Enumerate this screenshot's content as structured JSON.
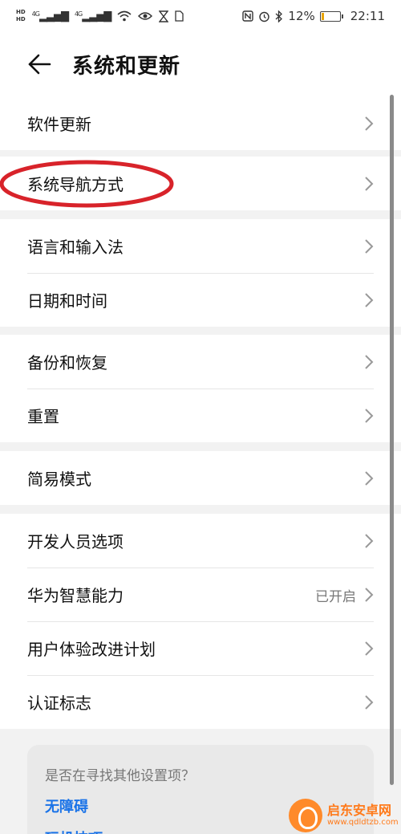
{
  "status_bar": {
    "left_hd1": "HD",
    "left_hd2": "HD",
    "net1": "4G",
    "net2": "4G",
    "icons": [
      "signal-icon",
      "wifi-icon",
      "eye-icon",
      "hourglass-icon",
      "sim-icon"
    ],
    "right_icons": [
      "nfc-icon",
      "alarm-icon",
      "bluetooth-icon"
    ],
    "battery_percent": "12%",
    "battery_level": 0.12,
    "time": "22:11"
  },
  "header": {
    "title": "系统和更新"
  },
  "groups": [
    {
      "items": [
        {
          "label": "软件更新",
          "value": ""
        }
      ]
    },
    {
      "items": [
        {
          "label": "系统导航方式",
          "value": ""
        }
      ]
    },
    {
      "items": [
        {
          "label": "语言和输入法",
          "value": ""
        },
        {
          "label": "日期和时间",
          "value": ""
        }
      ]
    },
    {
      "items": [
        {
          "label": "备份和恢复",
          "value": ""
        },
        {
          "label": "重置",
          "value": ""
        }
      ]
    },
    {
      "items": [
        {
          "label": "简易模式",
          "value": ""
        }
      ]
    },
    {
      "items": [
        {
          "label": "开发人员选项",
          "value": ""
        },
        {
          "label": "华为智慧能力",
          "value": "已开启"
        },
        {
          "label": "用户体验改进计划",
          "value": ""
        },
        {
          "label": "认证标志",
          "value": ""
        }
      ]
    }
  ],
  "suggestions": {
    "question": "是否在寻找其他设置项？",
    "links": [
      "无障碍",
      "玩机技巧"
    ]
  },
  "annotation": {
    "color": "#d8232a"
  },
  "watermark": {
    "name": "启东安卓网",
    "url": "www.qdldtzb.com"
  },
  "colors": {
    "accent": "#1a73e8",
    "battery": "#e8a400"
  }
}
